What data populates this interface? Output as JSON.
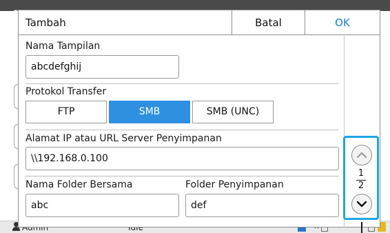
{
  "dialog": {
    "title": "Tambah",
    "cancel_label": "Batal",
    "ok_label": "OK"
  },
  "fields": {
    "display_name": {
      "label": "Nama Tampilan",
      "value": "abcdefghij"
    },
    "protocol": {
      "label": "Protokol Transfer",
      "options": [
        "FTP",
        "SMB",
        "SMB (UNC)"
      ],
      "selected": "SMB"
    },
    "server": {
      "label": "Alamat IP atau URL Server Penyimpanan",
      "value": "\\\\192.168.0.100"
    },
    "shared_folder": {
      "label": "Nama Folder Bersama",
      "value": "abc"
    },
    "storage_folder": {
      "label": "Folder Penyimpanan",
      "value": "def"
    }
  },
  "pagination": {
    "current": "1",
    "total": "2"
  },
  "status_bar": {
    "user": "Admin",
    "state": "Idle",
    "ink_label": "K"
  },
  "colors": {
    "accent": "#2f8fe0",
    "ok_text": "#1a7fd0",
    "highlight_border": "#1ea6e6"
  },
  "icons": {
    "scroll_up": "chevron-up-icon",
    "scroll_down": "chevron-down-icon",
    "user": "user-icon",
    "settings": "gear-icon"
  }
}
